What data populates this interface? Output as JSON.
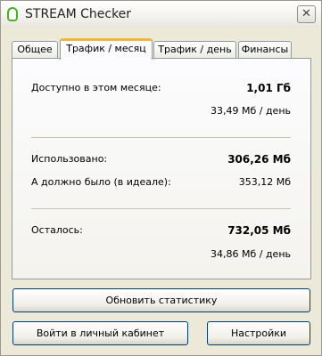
{
  "window": {
    "title": "STREAM Checker",
    "close_glyph": "✕"
  },
  "tabs": [
    {
      "label": "Общее"
    },
    {
      "label": "Трафик / месяц"
    },
    {
      "label": "Трафик / день"
    },
    {
      "label": "Финансы"
    }
  ],
  "traffic_month": {
    "available": {
      "label": "Доступно в этом месяце:",
      "value": "1,01 Гб",
      "per_day": "33,49 Мб / день"
    },
    "used": {
      "label": "Использовано:",
      "value": "306,26 Мб"
    },
    "should_be": {
      "label": "А должно было (в идеале):",
      "value": "353,12 Мб"
    },
    "remaining": {
      "label": "Осталось:",
      "value": "732,05 Мб",
      "per_day": "34,86 Мб / день"
    }
  },
  "buttons": {
    "refresh": "Обновить статистику",
    "login": "Войти в личный кабинет",
    "settings": "Настройки"
  }
}
